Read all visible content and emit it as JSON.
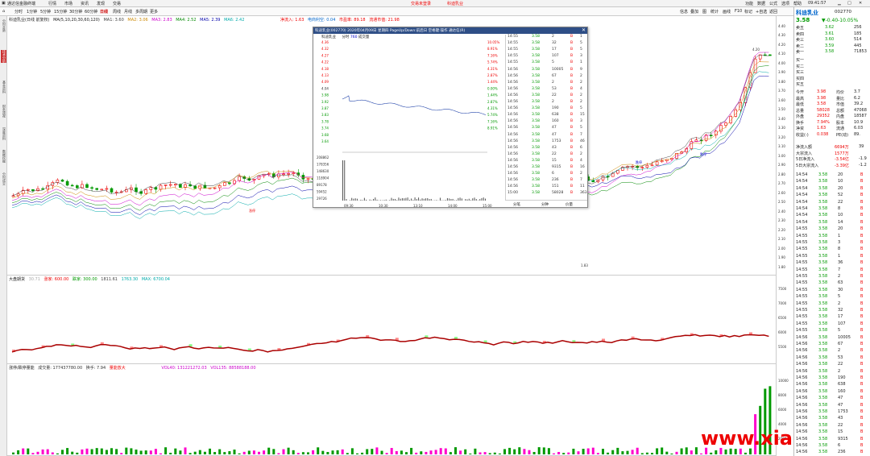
{
  "app": {
    "title": "通达信金融终端",
    "menus": [
      "行情",
      "市场",
      "资讯",
      "发现",
      "交易"
    ],
    "center": [
      "交易未登录",
      "科迪乳业"
    ],
    "right": [
      "功能",
      "数据",
      "公式",
      "选项",
      "帮助"
    ],
    "clock": "09:41:57"
  },
  "toolbar": {
    "periods": [
      "分时",
      "1分钟",
      "5分钟",
      "15分钟",
      "30分钟",
      "60分钟",
      "日线",
      "周线",
      "月线",
      "多周期",
      "更多"
    ],
    "right_tools": [
      "信息",
      "叠加",
      "图",
      "统计",
      "画线",
      "F10",
      "标记",
      "+自选",
      "返回"
    ]
  },
  "sidebar": [
    "分时走势",
    "技术分析",
    "基本资料",
    "财务透视",
    "深度资料",
    "数据挖掘",
    "分时成交",
    "历史分时",
    "同列",
    "画线"
  ],
  "main": {
    "stock": "科迪乳业(日线 前复权)",
    "ma": [
      "MA(5,10,20,30,60,120)",
      "MA1: 3.60",
      "MA2: 3.06",
      "MA3: 2.83",
      "MA4: 2.52",
      "MA5: 2.39",
      "MA6: 2.42"
    ],
    "extra": [
      "净流入: 1.63",
      "电商利空: 0.04",
      "市盈率: 89.18",
      "流通市值: 21.98"
    ],
    "yticks": [
      "4.40",
      "4.30",
      "4.20",
      "4.10",
      "4.00",
      "3.90",
      "3.80",
      "3.70",
      "3.60",
      "3.50",
      "3.40",
      "3.30",
      "3.20",
      "3.10",
      "3.00",
      "2.90",
      "2.80",
      "2.70",
      "2.60",
      "2.50",
      "2.40",
      "2.30",
      "2.20",
      "2.10",
      "2.00",
      "1.90",
      "1.80"
    ],
    "tags": [
      "涨停",
      "涨停",
      "涨停",
      "涨停",
      "涨停",
      "涨停",
      "跌停",
      "跌停"
    ],
    "low": "1.83",
    "high": "4.20"
  },
  "ind1": {
    "name": "大盘期货",
    "vals": [
      "30.71",
      "涨家: 600.00",
      "跌家: 300.00",
      "1811.61",
      "1763.30",
      "MAX: 6700.04"
    ],
    "yticks": [
      "7500",
      "7000",
      "6500",
      "6000",
      "5500"
    ]
  },
  "ind2": {
    "name": "涨停/跌停量能",
    "vals": [
      "成交量: 177437780.00",
      "换手: 7.94",
      "量能放大",
      "VOL40: 131221272.03",
      "VOL135: 88588188.00"
    ],
    "yticks": [
      "10000",
      "8000",
      "6000",
      "4000",
      "2000"
    ]
  },
  "overlay": {
    "title": "科迪乳业(002770) 2020年04月09日 星期四 PageUp/Down:前后日 空格键:操作 通达信(R)",
    "subtitle": [
      "科迪乳业",
      "分时",
      "760",
      "成交量"
    ],
    "prices": [
      "4.36",
      "4.32",
      "4.27",
      "4.22",
      "4.18",
      "4.13",
      "4.09",
      "4.04",
      "3.98",
      "3.92",
      "3.87",
      "3.83",
      "3.78",
      "3.74",
      "3.68",
      "3.64"
    ],
    "pcts": [
      "10.05%",
      "8.91%",
      "7.16%",
      "5.74%",
      "4.31%",
      "2.87%",
      "1.44%",
      "0.00%",
      "1.44%",
      "2.87%",
      "4.31%",
      "5.74%",
      "7.16%",
      "8.91%"
    ],
    "vols": [
      "208862",
      "178356",
      "148630",
      "118904",
      "89178",
      "59452",
      "29726"
    ],
    "times": [
      "09:30",
      "10:30",
      "13:10",
      "14:00",
      "15:00"
    ],
    "tabs": [
      "分笔",
      "分钟",
      "价量"
    ],
    "ticks": [
      [
        "14:55",
        "3.58",
        "2",
        "B",
        "1"
      ],
      [
        "14:55",
        "3.58",
        "32",
        "B",
        "5"
      ],
      [
        "14:55",
        "3.58",
        "17",
        "B",
        "5"
      ],
      [
        "14:55",
        "3.58",
        "107",
        "B",
        "3"
      ],
      [
        "14:55",
        "3.58",
        "5",
        "B",
        "1"
      ],
      [
        "14:56",
        "3.58",
        "10005",
        "B",
        "9"
      ],
      [
        "14:56",
        "3.58",
        "67",
        "B",
        "2"
      ],
      [
        "14:56",
        "3.58",
        "2",
        "B",
        "2"
      ],
      [
        "14:56",
        "3.58",
        "53",
        "B",
        "4"
      ],
      [
        "14:56",
        "3.58",
        "22",
        "B",
        "2"
      ],
      [
        "14:56",
        "3.58",
        "2",
        "B",
        "2"
      ],
      [
        "14:56",
        "3.58",
        "190",
        "B",
        "5"
      ],
      [
        "14:56",
        "3.58",
        "638",
        "B",
        "15"
      ],
      [
        "14:56",
        "3.58",
        "160",
        "B",
        "3"
      ],
      [
        "14:56",
        "3.58",
        "47",
        "B",
        "5"
      ],
      [
        "14:56",
        "3.58",
        "47",
        "B",
        "7"
      ],
      [
        "14:56",
        "3.58",
        "1753",
        "B",
        "46"
      ],
      [
        "14:56",
        "3.58",
        "43",
        "B",
        "6"
      ],
      [
        "14:56",
        "3.58",
        "22",
        "B",
        "2"
      ],
      [
        "14:56",
        "3.58",
        "15",
        "B",
        "4"
      ],
      [
        "14:56",
        "3.58",
        "9315",
        "B",
        "16"
      ],
      [
        "14:56",
        "3.58",
        "6",
        "B",
        "2"
      ],
      [
        "14:56",
        "3.58",
        "236",
        "B",
        "7"
      ],
      [
        "14:56",
        "3.58",
        "151",
        "B",
        "11"
      ],
      [
        "15:00",
        "3.58",
        "58028",
        "B",
        "363"
      ]
    ]
  },
  "right": {
    "name": "科迪乳业",
    "code": "002770",
    "price": "3.58",
    "chg": "▼-0.40-10.05%",
    "ask": [
      [
        "卖五",
        "3.62",
        "256"
      ],
      [
        "卖四",
        "3.61",
        "185"
      ],
      [
        "卖三",
        "3.60",
        "514"
      ],
      [
        "卖二",
        "3.59",
        "445"
      ],
      [
        "卖一",
        "3.58",
        "71853"
      ]
    ],
    "bid": [
      "买一",
      "买二",
      "买三",
      "买四",
      "买五"
    ],
    "stats": [
      [
        "今开",
        "3.98",
        "均价",
        "3.7"
      ],
      [
        "最高",
        "3.98",
        "量比",
        "6.2"
      ],
      [
        "最低",
        "3.58",
        "市值",
        "39.2"
      ],
      [
        "总量",
        "58028",
        "总额",
        "47068"
      ],
      [
        "外盘",
        "29352",
        "内盘",
        "18587"
      ],
      [
        "换手",
        "7.94%",
        "股本",
        "10.9"
      ],
      [
        "净资",
        "1.63",
        "流通",
        "6.03"
      ],
      [
        "收益(-)",
        "0.038",
        "PE(动)",
        "89."
      ]
    ],
    "flows": [
      [
        "净流入额",
        "6694万",
        "39"
      ],
      [
        "大宗流入",
        "1577万",
        ""
      ],
      [
        "5日净流入",
        "-3.54亿",
        "-1.9"
      ],
      [
        "5日大宗流入",
        "-3.39亿",
        "-1.2"
      ]
    ],
    "ticks": [
      [
        "14:54",
        "3.58",
        "20",
        "B"
      ],
      [
        "14:54",
        "3.58",
        "10",
        "B"
      ],
      [
        "14:54",
        "3.58",
        "20",
        "B"
      ],
      [
        "14:54",
        "3.58",
        "52",
        "B"
      ],
      [
        "14:54",
        "3.58",
        "22",
        "B"
      ],
      [
        "14:54",
        "3.58",
        "8",
        "B"
      ],
      [
        "14:54",
        "3.58",
        "10",
        "B"
      ],
      [
        "14:54",
        "3.58",
        "14",
        "B"
      ],
      [
        "14:55",
        "3.58",
        "20",
        "B"
      ],
      [
        "14:55",
        "3.58",
        "1",
        "B"
      ],
      [
        "14:55",
        "3.58",
        "3",
        "B"
      ],
      [
        "14:55",
        "3.58",
        "8",
        "B"
      ],
      [
        "14:55",
        "3.58",
        "1",
        "B"
      ],
      [
        "14:55",
        "3.58",
        "36",
        "B"
      ],
      [
        "14:55",
        "3.58",
        "7",
        "B"
      ],
      [
        "14:55",
        "3.58",
        "2",
        "B"
      ],
      [
        "14:55",
        "3.58",
        "63",
        "B"
      ],
      [
        "14:55",
        "3.58",
        "30",
        "B"
      ],
      [
        "14:55",
        "3.58",
        "5",
        "B"
      ],
      [
        "14:55",
        "3.58",
        "2",
        "B"
      ],
      [
        "14:55",
        "3.58",
        "32",
        "B"
      ],
      [
        "14:55",
        "3.58",
        "17",
        "B"
      ],
      [
        "14:55",
        "3.58",
        "107",
        "B"
      ],
      [
        "14:55",
        "3.58",
        "5",
        "B"
      ],
      [
        "14:56",
        "3.58",
        "10005",
        "B"
      ],
      [
        "14:56",
        "3.58",
        "67",
        "B"
      ],
      [
        "14:56",
        "3.58",
        "2",
        "B"
      ],
      [
        "14:56",
        "3.58",
        "53",
        "B"
      ],
      [
        "14:56",
        "3.58",
        "22",
        "B"
      ],
      [
        "14:56",
        "3.58",
        "2",
        "B"
      ],
      [
        "14:56",
        "3.58",
        "190",
        "B"
      ],
      [
        "14:56",
        "3.58",
        "638",
        "B"
      ],
      [
        "14:56",
        "3.58",
        "160",
        "B"
      ],
      [
        "14:56",
        "3.58",
        "47",
        "B"
      ],
      [
        "14:56",
        "3.58",
        "47",
        "B"
      ],
      [
        "14:56",
        "3.58",
        "1753",
        "B"
      ],
      [
        "14:56",
        "3.58",
        "43",
        "B"
      ],
      [
        "14:56",
        "3.58",
        "22",
        "B"
      ],
      [
        "14:56",
        "3.58",
        "15",
        "B"
      ],
      [
        "14:56",
        "3.58",
        "9315",
        "B"
      ],
      [
        "14:56",
        "3.58",
        "6",
        "B"
      ],
      [
        "14:56",
        "3.58",
        "236",
        "B"
      ]
    ]
  },
  "watermark": "www.xiari.com",
  "colors": {
    "up": "#e00000",
    "down": "#00a000",
    "title": "#2e4e86"
  }
}
